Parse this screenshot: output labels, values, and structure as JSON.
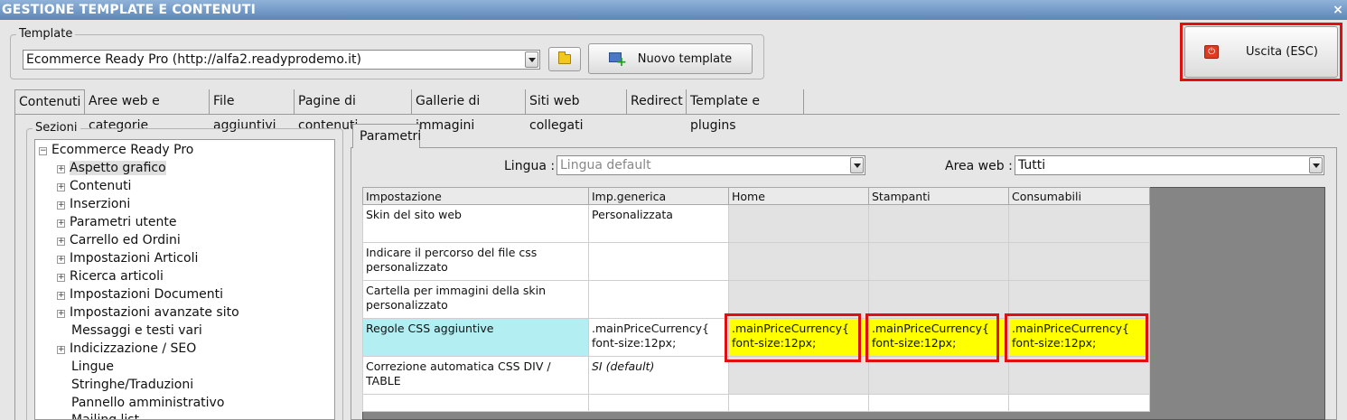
{
  "window": {
    "title": "GESTIONE TEMPLATE E CONTENUTI",
    "close_glyph": "×"
  },
  "template_group": {
    "legend": "Template",
    "selected": "Ecommerce Ready Pro (http://alfa2.readyprodemo.it)",
    "new_button": "Nuovo template"
  },
  "exit_button": "Uscita (ESC)",
  "tabs": [
    "Contenuti",
    "Aree web e categorie",
    "File aggiuntivi",
    "Pagine di contenuti",
    "Gallerie di immagini",
    "Siti web collegati",
    "Redirect",
    "Template e plugins"
  ],
  "sections": {
    "legend": "Sezioni",
    "root": "Ecommerce Ready Pro",
    "items": [
      {
        "label": "Aspetto grafico",
        "expandable": true
      },
      {
        "label": "Contenuti",
        "expandable": true
      },
      {
        "label": "Inserzioni",
        "expandable": true
      },
      {
        "label": "Parametri utente",
        "expandable": true
      },
      {
        "label": "Carrello ed Ordini",
        "expandable": true
      },
      {
        "label": "Impostazioni Articoli",
        "expandable": true
      },
      {
        "label": "Ricerca articoli",
        "expandable": true
      },
      {
        "label": "Impostazioni Documenti",
        "expandable": true
      },
      {
        "label": "Impostazioni avanzate sito",
        "expandable": true
      },
      {
        "label": "Messaggi e testi vari",
        "expandable": false
      },
      {
        "label": "Indicizzazione / SEO",
        "expandable": true
      },
      {
        "label": "Lingue",
        "expandable": false
      },
      {
        "label": "Stringhe/Traduzioni",
        "expandable": false
      },
      {
        "label": "Pannello amministrativo",
        "expandable": false
      },
      {
        "label": "Mailing list",
        "expandable": false
      }
    ]
  },
  "params": {
    "tab": "Parametri",
    "lingua_label": "Lingua :",
    "lingua_value": "Lingua default",
    "area_label": "Area web :",
    "area_value": "Tutti",
    "columns": [
      "Impostazione",
      "Imp.generica",
      "Home",
      "Stampanti",
      "Consumabili"
    ],
    "rows": [
      [
        "Skin del sito web",
        "Personalizzata",
        "",
        "",
        ""
      ],
      [
        "Indicare il percorso del file css personalizzato",
        "",
        "",
        "",
        ""
      ],
      [
        "Cartella per immagini della skin personalizzato",
        "",
        "",
        "",
        ""
      ],
      [
        "Regole CSS aggiuntive",
        ".mainPriceCurrency{ font-size:12px;",
        ".mainPriceCurrency{ font-size:12px;",
        ".mainPriceCurrency{ font-size:12px;",
        ".mainPriceCurrency{ font-size:12px;"
      ],
      [
        "Correzione automatica CSS DIV / TABLE",
        "SI (default)",
        "",
        "",
        ""
      ],
      [
        "",
        "",
        "",
        "",
        ""
      ]
    ]
  },
  "colors": {
    "highlight_row": "#b2eef2",
    "yellow": "#ffff00",
    "red_frame": "#e01010"
  },
  "icons": {
    "close": "close-icon",
    "folder": "folder-icon",
    "new_template": "new-template-icon",
    "exit": "power-icon"
  }
}
